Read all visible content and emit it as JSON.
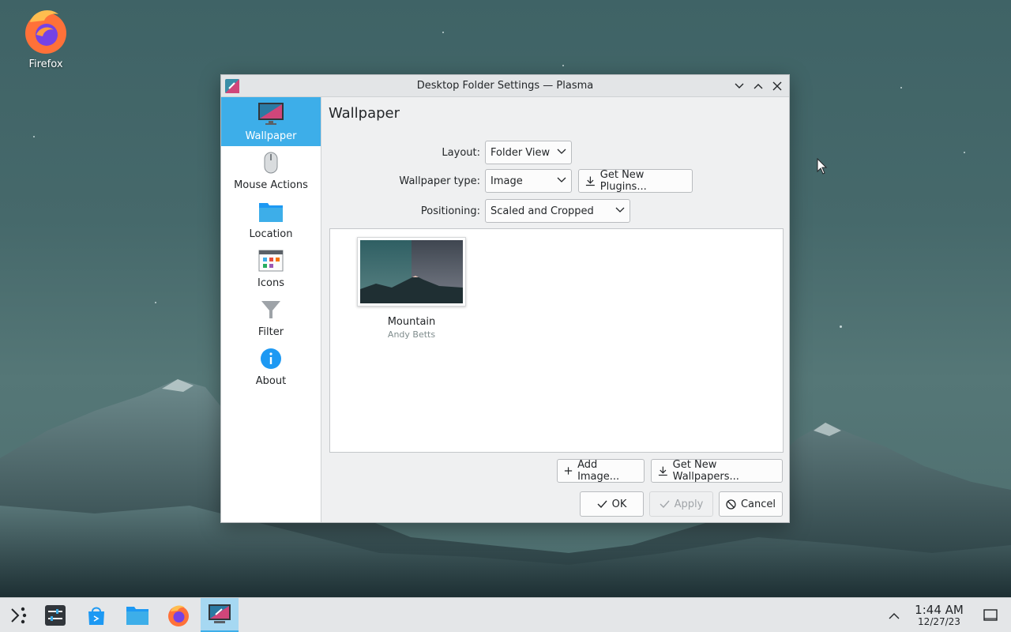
{
  "desktop": {
    "icons": [
      {
        "label": "Firefox",
        "icon": "firefox-icon"
      }
    ]
  },
  "window": {
    "title": "Desktop Folder Settings — Plasma",
    "app_icon": "plasma-settings-icon",
    "controls": [
      "minimize-icon",
      "maximize-icon",
      "close-icon"
    ]
  },
  "sidebar": {
    "items": [
      {
        "label": "Wallpaper",
        "icon": "monitor-wallpaper-icon",
        "active": true
      },
      {
        "label": "Mouse Actions",
        "icon": "mouse-icon",
        "active": false
      },
      {
        "label": "Location",
        "icon": "folder-icon",
        "active": false
      },
      {
        "label": "Icons",
        "icon": "icons-grid-icon",
        "active": false
      },
      {
        "label": "Filter",
        "icon": "filter-icon",
        "active": false
      },
      {
        "label": "About",
        "icon": "info-icon",
        "active": false
      }
    ]
  },
  "main": {
    "title": "Wallpaper",
    "layout": {
      "label": "Layout:",
      "value": "Folder View"
    },
    "wallpaper_type": {
      "label": "Wallpaper type:",
      "value": "Image",
      "get_plugins": "Get New Plugins..."
    },
    "positioning": {
      "label": "Positioning:",
      "value": "Scaled and Cropped"
    },
    "wallpapers": [
      {
        "name": "Mountain",
        "author": "Andy Betts",
        "selected": true
      }
    ],
    "add_image": "Add Image...",
    "get_wallpapers": "Get New Wallpapers...",
    "ok": "OK",
    "apply": "Apply",
    "cancel": "Cancel"
  },
  "taskbar": {
    "items": [
      {
        "icon": "app-launcher-icon"
      },
      {
        "icon": "system-settings-icon"
      },
      {
        "icon": "discover-store-icon"
      },
      {
        "icon": "dolphin-files-icon"
      },
      {
        "icon": "firefox-icon"
      },
      {
        "icon": "plasma-settings-icon",
        "active": true
      }
    ],
    "tray_expand_icon": "chevron-up-icon",
    "clock": {
      "time": "1:44 AM",
      "date": "12/27/23"
    },
    "show_desktop_icon": "show-desktop-icon"
  },
  "colors": {
    "accent": "#3daee9",
    "window_bg": "#eff0f1",
    "sky": "#46696b"
  }
}
